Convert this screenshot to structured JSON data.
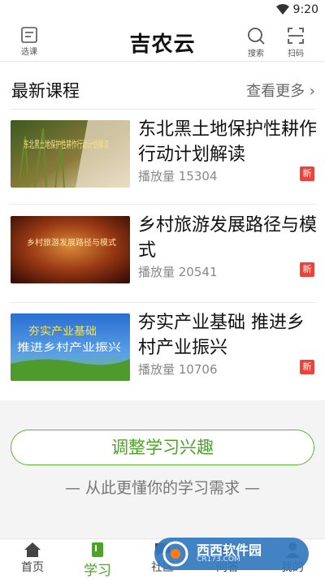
{
  "status": {
    "time": "9:20"
  },
  "appbar": {
    "title": "吉农云",
    "left_label": "选课",
    "search_label": "搜索",
    "scan_label": "扫码"
  },
  "section": {
    "title": "最新课程",
    "more": "查看更多 ›"
  },
  "courses": [
    {
      "title": "东北黑土地保护性耕作行动计划解读",
      "plays": "播放量 15304",
      "badge": "新",
      "thumb_text": "东北黑土地保护性耕作行动计划解读"
    },
    {
      "title": "乡村旅游发展路径与模式",
      "plays": "播放量 20541",
      "badge": "新",
      "thumb_text": "乡村旅游发展路径与模式"
    },
    {
      "title": "夯实产业基础 推进乡村产业振兴",
      "plays": "播放量 10706",
      "badge": "新",
      "thumb_text1": "夯实产业基础",
      "thumb_text2": "推进乡村产业振兴"
    }
  ],
  "interest": {
    "button": "调整学习兴趣",
    "subtitle": "— 从此更懂你的学习需求 —"
  },
  "tabs": [
    {
      "label": "首页",
      "icon": "home-icon"
    },
    {
      "label": "学习",
      "icon": "book-icon"
    },
    {
      "label": "社区",
      "icon": "chat-icon"
    },
    {
      "label": "问答",
      "icon": "qa-icon"
    },
    {
      "label": "我的",
      "icon": "user-icon"
    }
  ],
  "watermark": {
    "text": "西西软件园",
    "sub": "CR173.COM"
  },
  "colors": {
    "accent": "#4aa622",
    "badge": "#e8453c"
  }
}
